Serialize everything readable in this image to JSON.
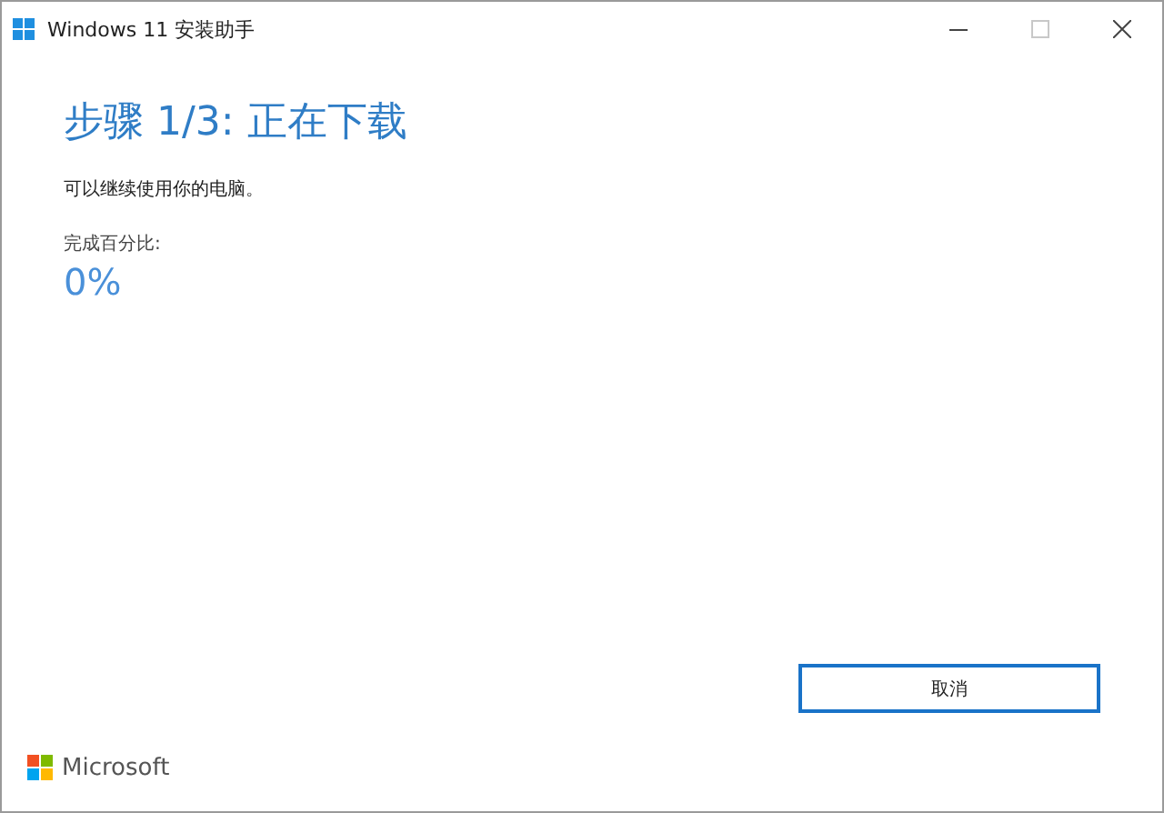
{
  "window": {
    "title": "Windows 11 安装助手",
    "controls": [
      {
        "kind": "minimize",
        "disabled": false
      },
      {
        "kind": "maximize",
        "disabled": true
      },
      {
        "kind": "close",
        "disabled": false
      }
    ]
  },
  "heading": "步骤 1/3: 正在下载",
  "subtitle": "可以继续使用你的电脑。",
  "progress": {
    "label": "完成百分比:",
    "value": "0%"
  },
  "buttons": [
    "取消"
  ],
  "footer": {
    "brand": "Microsoft"
  }
}
